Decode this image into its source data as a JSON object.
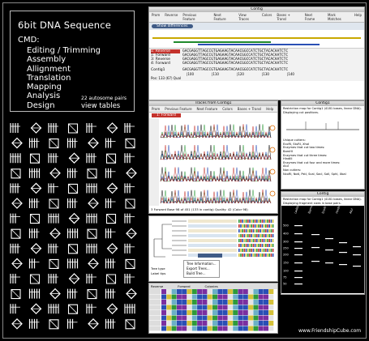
{
  "intro": {
    "title": "6bit  DNA   Sequence",
    "cmd": "CMD:",
    "items": [
      "Editing / Trimming",
      "Assembly",
      "Allignment",
      "Translation",
      "Mapping",
      "Analysis",
      "Design"
    ],
    "note": "22 autosome pairs",
    "view": "view tables"
  },
  "contig_window": {
    "title": "Contig",
    "toolbar": [
      "Prom",
      "Reverse",
      "Previous Feature",
      "Next Feature",
      "View Traces",
      "Colors",
      "Bases + Transl",
      "Next Frame",
      "Mark Matches",
      "Help"
    ],
    "show_diff": "Show differences",
    "rows": [
      {
        "label": "1: Reverse",
        "seq": "GACGAGGTTAGCCGTGAGAAGTACAACGGCCATCTGCTACACAATCTC"
      },
      {
        "label": "1: Forward",
        "seq": "GACGAGGTTAGCCGTGAGAAGTACAACGGCCATCTGCTACACAATCTC"
      },
      {
        "label": "3: Reverse",
        "seq": "GACGAGGTTAGCCGTGAGAAGTACAACGGCCATCTGCTACACAATCTC"
      },
      {
        "label": "4: Forward",
        "seq": "GACGAGGTTAGCCGTGAGAAGTACAACGGCCATCTGCTACACAATCTC"
      }
    ],
    "consensus_label": "Contig1",
    "consensus_seq": "GACGAGGTTAGCCGTGAGAAGTACAACGGCCATCTGCTACACAATCTC",
    "ruler": [
      "|100",
      "|110",
      "|120",
      "|130",
      "|140"
    ],
    "status": "Pos: 133 (67) Qual"
  },
  "traces_window": {
    "title": "Traces from Contig1",
    "toolbar": [
      "Prom",
      "Previous Feature",
      "Next Feature",
      "Colors",
      "Bases + Transl",
      "Help"
    ],
    "label": "1: Forward",
    "footer": "3 Forward Base 98 of 451 (133 in contig) Quality: 42 (Color 98)"
  },
  "contig_info_window": {
    "title": "Contig1",
    "lines": [
      "Restriction map for Contig1 (4181 bases, linear DNA).",
      "Displaying cut positions."
    ],
    "lines2": [
      "Unique cutters:",
      "EcoRI, StuRI, XhoI",
      "Enzymes that cut two times:",
      "BamHI",
      "Enzymes that cut three times:",
      "HindIII",
      "Enzymes that cut four and more times:",
      "AluI",
      "Non cutters:",
      "NcoRI, NotI, PstI, ScaI, SacI, SalI, SphI, XbaI"
    ]
  },
  "gel_window": {
    "title": "Contig",
    "lines": [
      "Restriction map for Contig1 (4181 bases, linear DNA).",
      "Displaying fragment sizes in base pairs."
    ],
    "lanes": [
      "Ladder",
      "BamHI",
      "EcoRI",
      "HindIII",
      "AluI"
    ],
    "sizes": [
      "500",
      "400",
      "300",
      "250",
      "200",
      "150",
      "100",
      "75",
      "50"
    ]
  },
  "tree_window": {
    "menu": [
      "Tree Information...",
      "Export Trees...",
      "Build Tree..."
    ],
    "checks": [
      "Tree type",
      "Label tips"
    ]
  },
  "table_window": {
    "headers": [
      "Reverse",
      "Forward",
      "Colonies"
    ]
  },
  "colors": {
    "accent": "#3f5b86",
    "red": "#c4322c",
    "green": "#2e9a3a",
    "blue": "#2a4fb5",
    "yellow": "#d6c23a"
  },
  "watermark": "www.FriendshipCube.com"
}
